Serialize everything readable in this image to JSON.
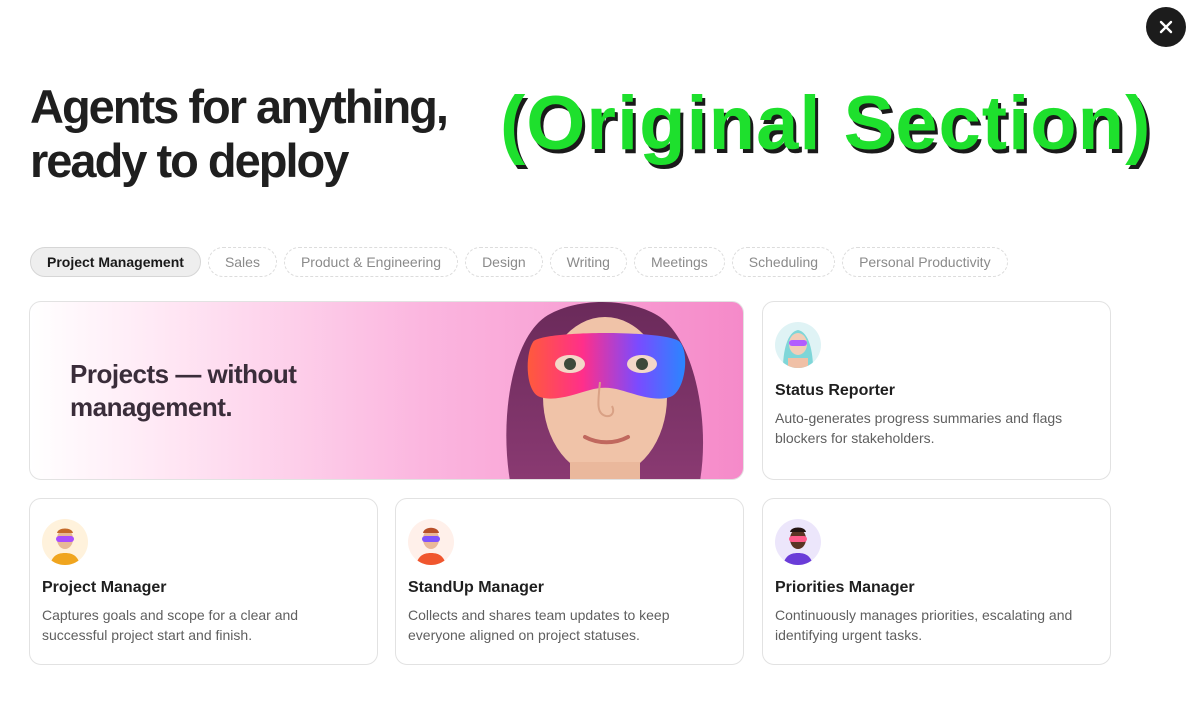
{
  "close": {
    "icon": "close-icon"
  },
  "heading": {
    "line1": "Agents for anything,",
    "line2": "ready to deploy"
  },
  "overlay_label": "(Original Section)",
  "tabs": [
    {
      "label": "Project Management",
      "active": true
    },
    {
      "label": "Sales"
    },
    {
      "label": "Product & Engineering"
    },
    {
      "label": "Design"
    },
    {
      "label": "Writing"
    },
    {
      "label": "Meetings"
    },
    {
      "label": "Scheduling"
    },
    {
      "label": "Personal Productivity"
    }
  ],
  "hero": {
    "text": "Projects — without management."
  },
  "agents": [
    {
      "title": "Status Reporter",
      "desc": "Auto-generates progress summaries and flags blockers for stakeholders."
    },
    {
      "title": "Project Manager",
      "desc": "Captures goals and scope for a clear and successful project start and finish."
    },
    {
      "title": "StandUp Manager",
      "desc": "Collects and shares team updates to keep everyone aligned on project statuses."
    },
    {
      "title": "Priorities Manager",
      "desc": "Continuously manages priorities, escalating and identifying urgent tasks."
    }
  ],
  "colors": {
    "accent_green": "#1ee02d",
    "hero_pink": "#f58ac9",
    "close_bg": "#1c1c1c"
  }
}
